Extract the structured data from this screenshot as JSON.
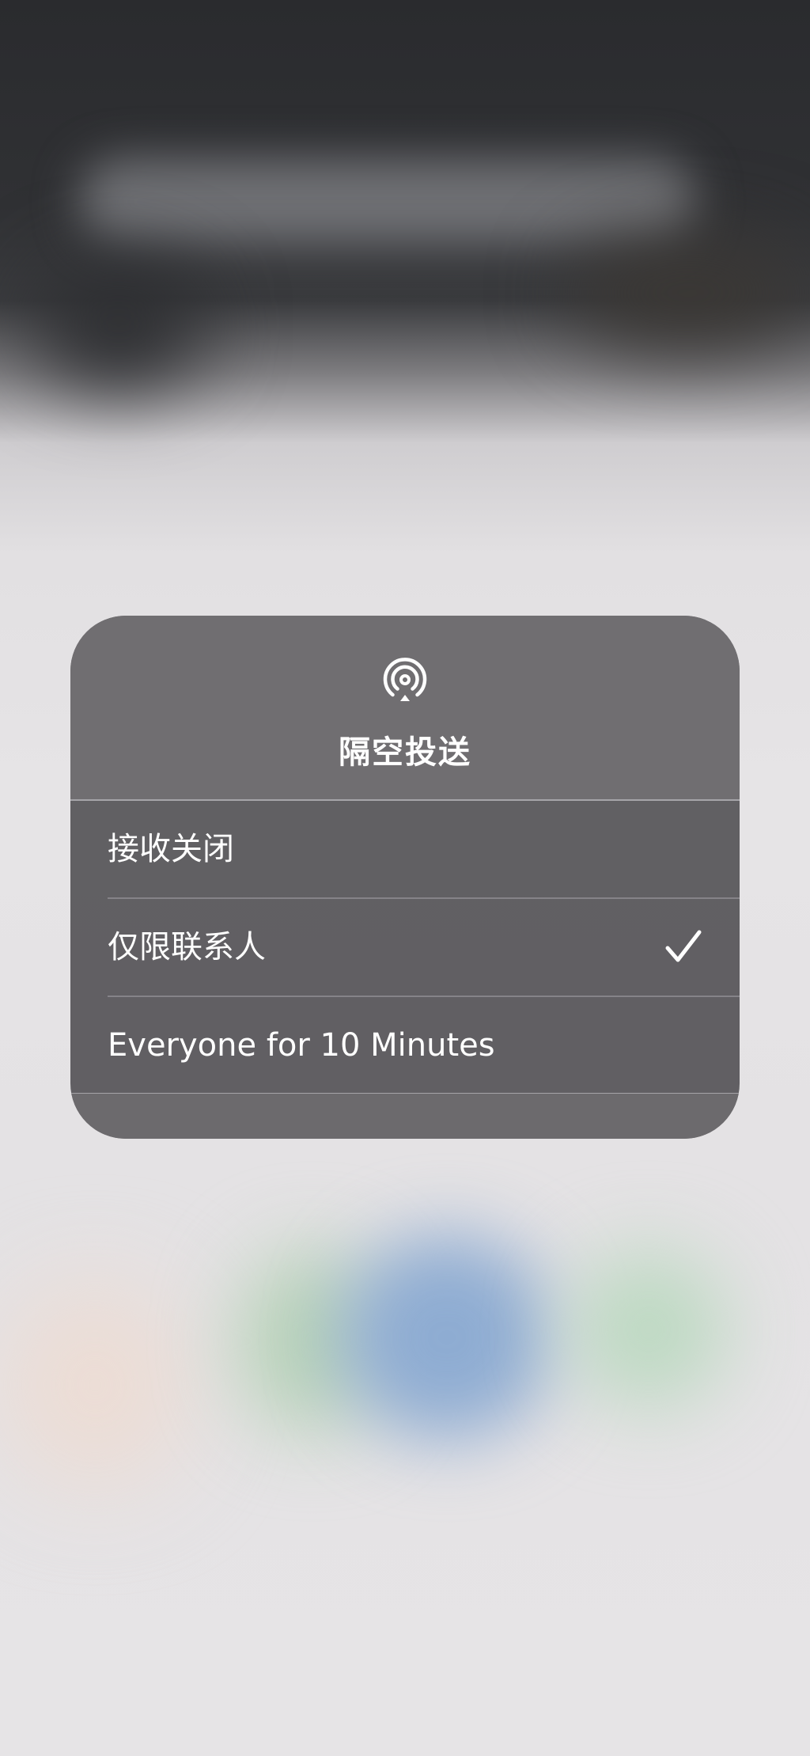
{
  "airdrop_menu": {
    "icon": "airdrop-icon",
    "title": "隔空投送",
    "options": [
      {
        "label": "接收关闭",
        "selected": false
      },
      {
        "label": "仅限联系人",
        "selected": true
      },
      {
        "label": "Everyone for 10 Minutes",
        "selected": false
      }
    ],
    "selected_indicator_icon": "checkmark-icon"
  },
  "colors": {
    "menu_background": "#5c5b5e",
    "menu_header_background": "#706e71",
    "text": "#ffffff"
  }
}
